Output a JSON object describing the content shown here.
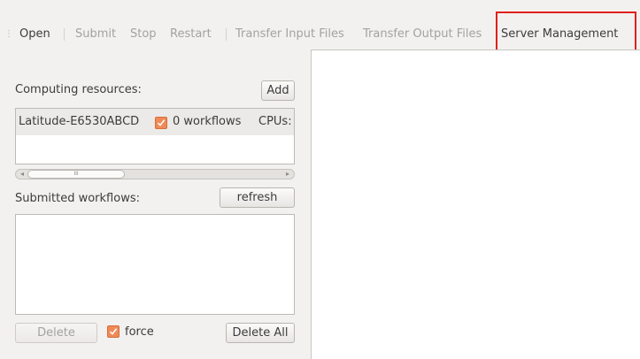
{
  "toolbar": {
    "open": "Open",
    "submit": "Submit",
    "stop": "Stop",
    "restart": "Restart",
    "transfer_input": "Transfer Input Files",
    "transfer_output": "Transfer Output Files",
    "server_management": "Server Management"
  },
  "computing": {
    "label": "Computing resources:",
    "add_button": "Add",
    "rows": [
      {
        "host": "Latitude-E6530ABCD",
        "checked": true,
        "workflows": "0 workflows",
        "cpus": "CPUs:"
      }
    ]
  },
  "scrollbar": {
    "thumb_grip": "III"
  },
  "submitted": {
    "label": "Submitted workflows:",
    "refresh_button": "refresh",
    "items": []
  },
  "actions": {
    "delete_button": "Delete",
    "force_label": "force",
    "force_checked": true,
    "delete_all_button": "Delete All"
  },
  "colors": {
    "accent_check": "#ef8a57",
    "highlight_box": "#e0201c",
    "panel_bg": "#f2f1f0"
  },
  "icons": {
    "checkmark": "checkmark-icon",
    "scroll_left": "arrow-left-icon",
    "scroll_right": "arrow-right-icon",
    "toolbar_grip": "grip-icon"
  }
}
